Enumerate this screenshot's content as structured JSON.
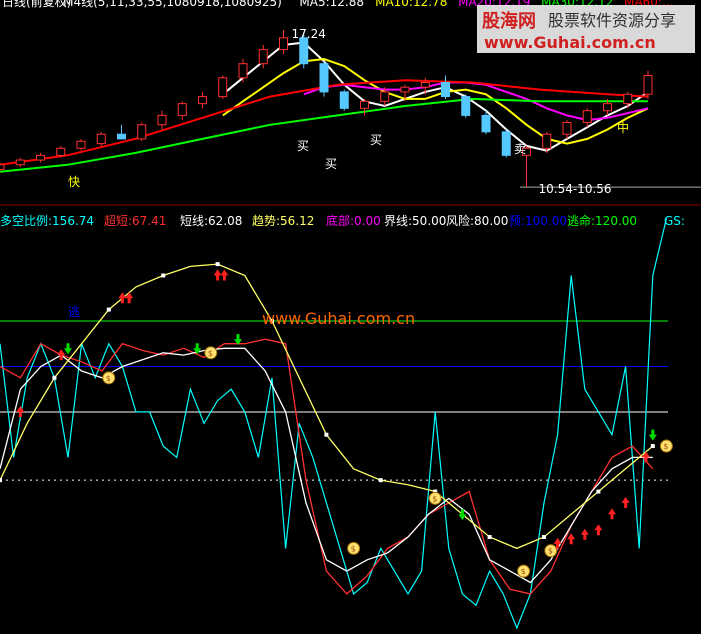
{
  "top_panel": {
    "header": [
      {
        "text": "日线(前复权)",
        "color": "#ffffff"
      },
      {
        "text": "M4线(5,11,33,55,1080918,1080925)",
        "color": "#ffffff"
      },
      {
        "text": "MA5:12.88",
        "color": "#ffffff"
      },
      {
        "text": "MA10:12.78",
        "color": "#ffff00"
      },
      {
        "text": "MA20:12.19",
        "color": "#ff00ff"
      },
      {
        "text": "MA30:12.12",
        "color": "#00ff00"
      },
      {
        "text": "MA60:...",
        "color": "#ff0000"
      }
    ],
    "high_label": "17.24",
    "low_label": "10.54-10.56",
    "signal_labels": [
      {
        "text": "快",
        "color": "#ffff00"
      },
      {
        "text": "买",
        "color": "#ffffff"
      },
      {
        "text": "买",
        "color": "#ffffff"
      },
      {
        "text": "买",
        "color": "#ffffff"
      },
      {
        "text": "卖",
        "color": "#ffffff"
      },
      {
        "text": "中",
        "color": "#ffff00"
      }
    ],
    "colors": {
      "up_candle": "#ff3030",
      "down_candle": "#54c8ff",
      "ma5": "#ffffff",
      "ma10": "#ffff00",
      "ma20": "#ff00ff",
      "ma30": "#00ff00",
      "ma60": "#ff0000"
    }
  },
  "indicator_header": [
    {
      "text": "多空比例:156.74",
      "color": "#00ffff"
    },
    {
      "text": "超短:67.41",
      "color": "#ff3030"
    },
    {
      "text": "短线:62.08",
      "color": "#ffffff"
    },
    {
      "text": "趋势:56.12",
      "color": "#ffff66"
    },
    {
      "text": "底部:0.00",
      "color": "#ff00ff"
    },
    {
      "text": "界线:50.00",
      "color": "#ffffff"
    },
    {
      "text": "风险:80.00",
      "color": "#ffffff"
    },
    {
      "text": "预:100.00",
      "color": "#0000ff"
    },
    {
      "text": "逃命:120.00",
      "color": "#00ff00"
    },
    {
      "text": "GS:",
      "color": "#00ffff"
    }
  ],
  "panel_label": "逃",
  "watermark": {
    "logo": "股海网",
    "slogan": "股票软件资源分享",
    "url": "www.Guhai.com.cn",
    "center_url": "www.Guhai.com.cn"
  },
  "chart_data": [
    {
      "type": "line",
      "name": "price",
      "xlim": [
        0,
        100
      ],
      "ylim": [
        10.0,
        18.0
      ],
      "price_levels": [
        {
          "value": 17.24,
          "label": "high"
        },
        {
          "value": 10.55,
          "label": "low"
        }
      ],
      "ohlc": [
        [
          0,
          11.3,
          11.6,
          11.2,
          11.5
        ],
        [
          3,
          11.5,
          11.8,
          11.4,
          11.7
        ],
        [
          6,
          11.7,
          12.0,
          11.6,
          11.9
        ],
        [
          9,
          11.9,
          12.3,
          11.8,
          12.2
        ],
        [
          12,
          12.2,
          12.6,
          12.1,
          12.5
        ],
        [
          15,
          12.4,
          12.9,
          12.3,
          12.8
        ],
        [
          18,
          12.8,
          13.2,
          12.6,
          12.6
        ],
        [
          21,
          12.6,
          13.3,
          12.5,
          13.2
        ],
        [
          24,
          13.2,
          13.8,
          13.0,
          13.6
        ],
        [
          27,
          13.6,
          14.2,
          13.4,
          14.1
        ],
        [
          30,
          14.1,
          14.6,
          13.9,
          14.4
        ],
        [
          33,
          14.4,
          15.3,
          14.3,
          15.2
        ],
        [
          36,
          15.2,
          16.0,
          15.0,
          15.8
        ],
        [
          39,
          15.8,
          16.6,
          15.6,
          16.4
        ],
        [
          42,
          16.4,
          17.24,
          16.2,
          16.9
        ],
        [
          45,
          16.9,
          17.1,
          15.6,
          15.8
        ],
        [
          48,
          15.8,
          15.9,
          14.4,
          14.6
        ],
        [
          51,
          14.6,
          14.7,
          13.8,
          13.9
        ],
        [
          54,
          13.9,
          14.3,
          13.6,
          14.2
        ],
        [
          57,
          14.2,
          14.8,
          14.0,
          14.6
        ],
        [
          60,
          14.6,
          14.9,
          14.2,
          14.8
        ],
        [
          63,
          14.8,
          15.2,
          14.5,
          15.0
        ],
        [
          66,
          15.0,
          15.3,
          14.3,
          14.4
        ],
        [
          69,
          14.4,
          14.5,
          13.5,
          13.6
        ],
        [
          72,
          13.6,
          13.8,
          12.8,
          12.9
        ],
        [
          75,
          12.9,
          13.0,
          11.8,
          11.9
        ],
        [
          78,
          11.9,
          12.3,
          10.54,
          12.2
        ],
        [
          81,
          12.2,
          12.9,
          12.0,
          12.8
        ],
        [
          84,
          12.8,
          13.4,
          12.6,
          13.3
        ],
        [
          87,
          13.3,
          13.9,
          13.1,
          13.8
        ],
        [
          90,
          13.8,
          14.3,
          13.6,
          14.1
        ],
        [
          93,
          14.1,
          14.6,
          13.9,
          14.5
        ],
        [
          96,
          14.5,
          15.5,
          14.3,
          15.3
        ]
      ],
      "series": [
        {
          "name": "MA5",
          "x": [
            33,
            36,
            39,
            42,
            45,
            48,
            51,
            54,
            57,
            60,
            63,
            66,
            69,
            72,
            75,
            78,
            81,
            84,
            87,
            90,
            93,
            96
          ],
          "values": [
            14.5,
            15.2,
            15.9,
            16.6,
            16.7,
            15.9,
            14.9,
            14.2,
            14.0,
            14.3,
            14.6,
            14.8,
            14.4,
            13.8,
            13.0,
            12.3,
            12.1,
            12.6,
            13.1,
            13.6,
            14.0,
            14.6
          ]
        },
        {
          "name": "MA10",
          "x": [
            33,
            36,
            39,
            42,
            45,
            48,
            51,
            54,
            57,
            60,
            63,
            66,
            69,
            72,
            75,
            78,
            81,
            84,
            87,
            90,
            93,
            96
          ],
          "values": [
            13.6,
            14.2,
            14.8,
            15.4,
            15.9,
            16.0,
            15.7,
            15.1,
            14.6,
            14.3,
            14.3,
            14.6,
            14.7,
            14.5,
            13.9,
            13.2,
            12.6,
            12.4,
            12.6,
            13.0,
            13.5,
            13.9
          ]
        },
        {
          "name": "MA20",
          "x": [
            45,
            48,
            51,
            54,
            57,
            60,
            63,
            66,
            69,
            72,
            75,
            78,
            81,
            84,
            87,
            90,
            93,
            96
          ],
          "values": [
            14.5,
            14.8,
            14.9,
            14.8,
            14.7,
            14.7,
            14.8,
            15.0,
            15.0,
            14.9,
            14.6,
            14.3,
            13.9,
            13.6,
            13.4,
            13.5,
            13.7,
            13.9
          ]
        },
        {
          "name": "MA30",
          "x": [
            0,
            10,
            20,
            30,
            40,
            50,
            60,
            70,
            80,
            90,
            96
          ],
          "values": [
            11.2,
            11.5,
            12.0,
            12.6,
            13.2,
            13.6,
            14.0,
            14.3,
            14.2,
            14.2,
            14.2
          ]
        },
        {
          "name": "MA60",
          "x": [
            0,
            10,
            20,
            30,
            40,
            50,
            60,
            70,
            80,
            90,
            96
          ],
          "values": [
            11.5,
            11.9,
            12.6,
            13.5,
            14.4,
            14.9,
            15.1,
            15.0,
            14.7,
            14.5,
            14.4
          ]
        }
      ]
    },
    {
      "type": "line",
      "name": "indicator",
      "xlim": [
        0,
        100
      ],
      "ylim": [
        -15,
        160
      ],
      "reference_lines": [
        {
          "name": "逃命",
          "value": 120,
          "color": "#00ff00"
        },
        {
          "name": "预",
          "value": 100,
          "color": "#0000ff"
        },
        {
          "name": "风险",
          "value": 80,
          "color": "#ffffff"
        },
        {
          "name": "界线",
          "value": 50,
          "color": "#ffffff",
          "dashed": true
        }
      ],
      "series": [
        {
          "name": "多空比例",
          "color": "#00ffff",
          "x": [
            0,
            2,
            4,
            6,
            8,
            10,
            12,
            14,
            16,
            18,
            20,
            22,
            24,
            26,
            28,
            30,
            32,
            34,
            36,
            38,
            40,
            42,
            44,
            46,
            48,
            50,
            52,
            54,
            56,
            58,
            60,
            62,
            64,
            66,
            68,
            70,
            72,
            74,
            76,
            78,
            80,
            82,
            84,
            86,
            88,
            90,
            92,
            94,
            96,
            98
          ],
          "values": [
            110,
            60,
            95,
            110,
            95,
            60,
            110,
            95,
            110,
            100,
            80,
            80,
            65,
            60,
            90,
            75,
            85,
            90,
            80,
            60,
            95,
            20,
            75,
            60,
            40,
            20,
            0,
            5,
            20,
            10,
            0,
            10,
            80,
            20,
            0,
            -5,
            10,
            0,
            -15,
            0,
            40,
            70,
            140,
            90,
            80,
            70,
            100,
            20,
            140,
            165
          ]
        },
        {
          "name": "超短",
          "color": "#ff3030",
          "x": [
            0,
            3,
            6,
            9,
            12,
            15,
            18,
            21,
            24,
            27,
            30,
            33,
            36,
            39,
            42,
            45,
            48,
            51,
            54,
            57,
            60,
            63,
            66,
            69,
            72,
            75,
            78,
            81,
            84,
            87,
            90,
            93,
            96
          ],
          "values": [
            100,
            95,
            110,
            105,
            102,
            98,
            110,
            107,
            105,
            108,
            104,
            110,
            110,
            112,
            110,
            50,
            10,
            0,
            8,
            20,
            25,
            35,
            40,
            45,
            15,
            2,
            0,
            10,
            30,
            45,
            60,
            65,
            55
          ]
        },
        {
          "name": "短线",
          "color": "#ffffff",
          "x": [
            0,
            3,
            6,
            9,
            12,
            15,
            18,
            21,
            24,
            27,
            30,
            33,
            36,
            39,
            42,
            45,
            48,
            51,
            54,
            57,
            60,
            63,
            66,
            69,
            72,
            75,
            78,
            81,
            84,
            87,
            90,
            93,
            96
          ],
          "values": [
            55,
            90,
            100,
            105,
            98,
            95,
            100,
            103,
            106,
            105,
            107,
            108,
            108,
            98,
            80,
            40,
            15,
            10,
            15,
            18,
            25,
            35,
            42,
            35,
            15,
            10,
            5,
            15,
            30,
            45,
            55,
            60,
            60
          ]
        },
        {
          "name": "趋势",
          "color": "#ffff66",
          "x": [
            0,
            4,
            8,
            12,
            16,
            20,
            24,
            28,
            32,
            36,
            40,
            44,
            48,
            52,
            56,
            60,
            64,
            68,
            72,
            76,
            80,
            84,
            88,
            92,
            96
          ],
          "values": [
            50,
            75,
            95,
            110,
            125,
            135,
            140,
            144,
            145,
            140,
            120,
            95,
            70,
            55,
            50,
            48,
            45,
            35,
            25,
            20,
            25,
            35,
            45,
            55,
            65
          ]
        }
      ]
    }
  ]
}
